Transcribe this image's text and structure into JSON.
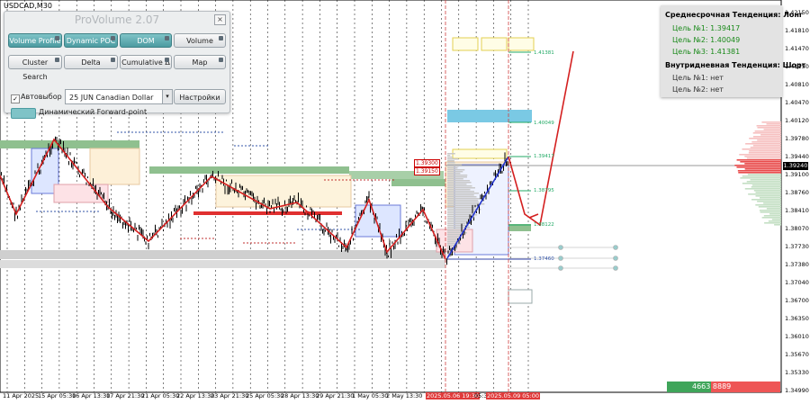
{
  "symbol": "USDCAD,M30",
  "panel": {
    "title": "ProVolume 2.07",
    "close": "×",
    "buttons": {
      "volume_profile": "Volume Profile",
      "dynamic_poc": "Dynamic POC",
      "dom": "DOM",
      "volume": "Volume",
      "cluster_search": "Cluster Search",
      "delta": "Delta",
      "cumulative_delta": "Cumulative Δ",
      "map": "Map",
      "settings": "Настройки"
    },
    "auto_select_label": "Автовыбор",
    "auto_select_checked": "✓",
    "contract_value": "25 JUN Canadian Dollar",
    "combo_arrow": "▾",
    "forward_point_label": "Динамический Forward-point"
  },
  "targets": {
    "long_heading": "Среднесрочная Тенденция: Лонг",
    "long_target1": "Цель №1:  1.39417",
    "long_target2": "Цель №2:  1.40049",
    "long_target3": "Цель №3:  1.41381",
    "short_heading": "Внутридневная Тенденция: Шорт",
    "short_target1": "Цель №1:  нет",
    "short_target2": "Цель №2:  нет"
  },
  "price_axis": [
    "1.42150",
    "1.41810",
    "1.41470",
    "1.41150",
    "1.40810",
    "1.40470",
    "1.40120",
    "1.39780",
    "1.39440",
    "1.39100",
    "1.38760",
    "1.38410",
    "1.38070",
    "1.37730",
    "1.37380",
    "1.37040",
    "1.36700",
    "1.36350",
    "1.36010",
    "1.35670",
    "1.35330",
    "1.34990"
  ],
  "current_price": "1.39240",
  "time_axis": [
    "11 Apr 2025",
    "15 Apr 05:30",
    "16 Apr 13:30",
    "17 Apr 21:30",
    "21 Apr 05:30",
    "22 Apr 13:30",
    "23 Apr 21:30",
    "25 Apr 05:30",
    "28 Apr 13:30",
    "29 Apr 21:30",
    "1 May 05:30",
    "2 May 13:30",
    "2025.05.06 19:30",
    "05:30",
    "2025.05.09 05:00"
  ],
  "levels": {
    "l1": "1.41381",
    "l2": "1.40049",
    "l3": "1.39417",
    "l4": "1.38795",
    "l5": "1.38122",
    "l6": "1.37460",
    "tag1": "1.39300",
    "tag2": "1.39150"
  },
  "volume_box": "4663  8889",
  "colors": {
    "bull_line": "#d42020",
    "blue_trend": "#2233cc",
    "volume_green": "#3fa55a",
    "volume_red": "#ee5555",
    "accent_teal": "#5aa9ae"
  }
}
